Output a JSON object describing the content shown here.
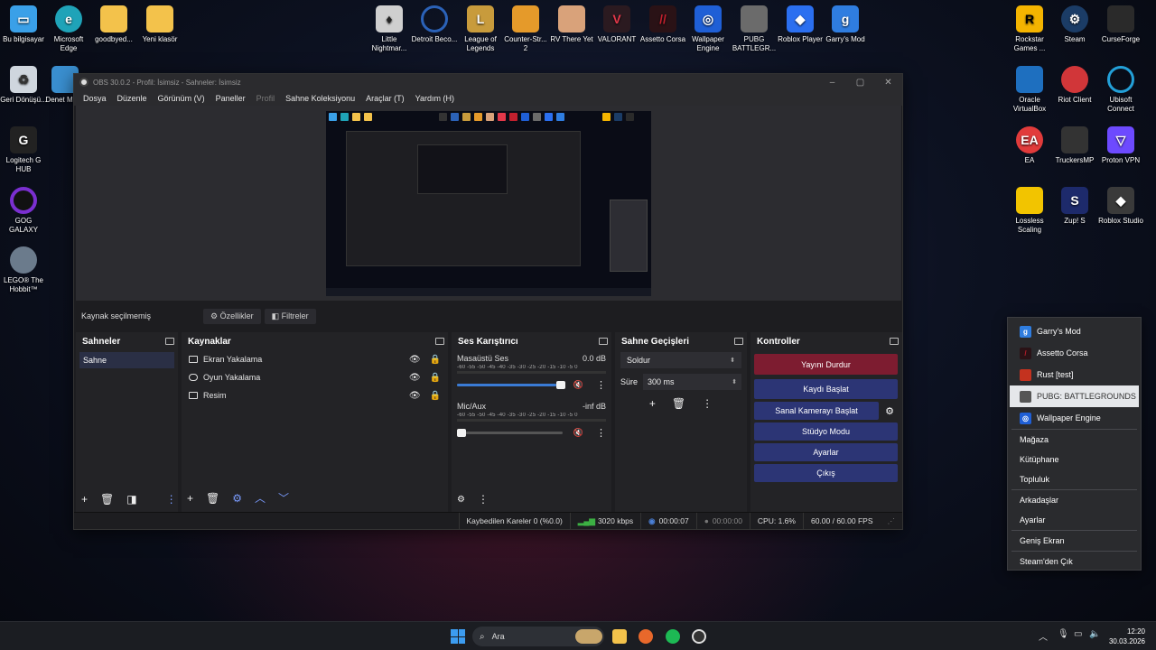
{
  "desktop": {
    "left_icons": [
      {
        "label": "Bu bilgisayar",
        "icon": "monitor-icon",
        "color": "#3aa0e8"
      },
      {
        "label": "Microsoft Edge",
        "icon": "edge-icon",
        "color": "#1fa3b8"
      },
      {
        "label": "goodbyed...",
        "icon": "folder-icon",
        "color": "#f3c24b"
      },
      {
        "label": "Yeni klasör",
        "icon": "folder-icon",
        "color": "#f3c24b"
      },
      {
        "label": "Geri Dönüşü...",
        "icon": "recycle-bin-icon",
        "color": "#cfd6de"
      },
      {
        "label": "Denet Masa",
        "icon": "control-panel-icon",
        "color": "#3a8fd0"
      },
      {
        "label": "Logitech G HUB",
        "icon": "logitech-icon",
        "color": "#222222"
      },
      {
        "label": "GOG GALAXY",
        "icon": "gog-icon",
        "color": "#7a2fd0"
      },
      {
        "label": "LEGO® The Hobbit™",
        "icon": "lego-hobbit-icon",
        "color": "#6b7b8c"
      }
    ],
    "top_icons": [
      {
        "label": "Little Nightmar...",
        "icon": "little-nightmares-icon",
        "color": "#cfcfcf"
      },
      {
        "label": "Detroit Beco...",
        "icon": "detroit-icon",
        "color": "#2b62b8"
      },
      {
        "label": "League of Legends",
        "icon": "lol-icon",
        "color": "#c89b3c"
      },
      {
        "label": "Counter-Str... 2",
        "icon": "cs2-icon",
        "color": "#e59a2a"
      },
      {
        "label": "RV There Yet",
        "icon": "rv-there-yet-icon",
        "color": "#d9a27a"
      },
      {
        "label": "VALORANT",
        "icon": "valorant-icon",
        "color": "#e3384a"
      },
      {
        "label": "Assetto Corsa",
        "icon": "assetto-corsa-icon",
        "color": "#c2202e"
      },
      {
        "label": "Wallpaper Engine",
        "icon": "wallpaper-engine-icon",
        "color": "#1f5fd6"
      },
      {
        "label": "PUBG BATTLEGR...",
        "icon": "pubg-icon",
        "color": "#6b6b6b"
      },
      {
        "label": "Roblox Player",
        "icon": "roblox-icon",
        "color": "#2b6ff0"
      },
      {
        "label": "Garry's Mod",
        "icon": "garrys-mod-icon",
        "color": "#2f7de0"
      }
    ],
    "right_icons": [
      {
        "label": "Rockstar Games ...",
        "icon": "rockstar-icon",
        "color": "#f4b400"
      },
      {
        "label": "Steam",
        "icon": "steam-icon",
        "color": "#1b3c66"
      },
      {
        "label": "CurseForge",
        "icon": "curseforge-icon",
        "color": "#2a2a2a"
      },
      {
        "label": "Oracle VirtualBox",
        "icon": "virtualbox-icon",
        "color": "#1e6fbf"
      },
      {
        "label": "Riot Client",
        "icon": "riot-icon",
        "color": "#d13639"
      },
      {
        "label": "Ubisoft Connect",
        "icon": "ubisoft-icon",
        "color": "#23a0d8"
      },
      {
        "label": "EA",
        "icon": "ea-icon",
        "color": "#e13b3b"
      },
      {
        "label": "TruckersMP",
        "icon": "truckersmp-icon",
        "color": "#333333"
      },
      {
        "label": "Proton VPN",
        "icon": "protonvpn-icon",
        "color": "#6d4aff"
      },
      {
        "label": "Lossless Scaling",
        "icon": "lossless-scaling-icon",
        "color": "#f2c400"
      },
      {
        "label": "Zup! S",
        "icon": "zup-icon",
        "color": "#1d2a6b"
      },
      {
        "label": "Roblox Studio",
        "icon": "roblox-studio-icon",
        "color": "#3a3a3a"
      }
    ]
  },
  "obs": {
    "title": "OBS 30.0.2 - Profil: İsimsiz - Sahneler: İsimsiz",
    "menu": [
      "Dosya",
      "Düzenle",
      "Görünüm (V)",
      "Paneller",
      "Profil",
      "Sahne Koleksiyonu",
      "Araçlar (T)",
      "Yardım (H)"
    ],
    "source_bar": {
      "no_selection": "Kaynak seçilmemiş",
      "properties": "Özellikler",
      "filters": "Filtreler"
    },
    "scenes": {
      "title": "Sahneler",
      "items": [
        "Sahne"
      ]
    },
    "sources": {
      "title": "Kaynaklar",
      "items": [
        "Ekran Yakalama",
        "Oyun Yakalama",
        "Resim"
      ]
    },
    "mixer": {
      "title": "Ses Karıştırıcı",
      "scale": "-60 -55 -50 -45 -40 -35 -30 -25 -20 -15 -10 -5 0",
      "channels": [
        {
          "name": "Masaüstü Ses",
          "level": "0.0 dB",
          "volume": 1.0
        },
        {
          "name": "Mic/Aux",
          "level": "-inf dB",
          "volume": 0.0
        }
      ]
    },
    "transitions": {
      "title": "Sahne Geçişleri",
      "selected": "Soldur",
      "duration_label": "Süre",
      "duration_value": "300 ms"
    },
    "controls": {
      "title": "Kontroller",
      "stop_stream": "Yayını Durdur",
      "start_record": "Kaydı Başlat",
      "virtual_cam": "Sanal Kamerayı Başlat",
      "studio_mode": "Stüdyo Modu",
      "settings": "Ayarlar",
      "exit": "Çıkış"
    },
    "status": {
      "dropped": "Kaybedilen Kareler 0 (%0.0)",
      "bitrate": "3020 kbps",
      "stream_time": "00:00:07",
      "record_time": "00:00:00",
      "cpu": "CPU: 1.6%",
      "fps": "60.00 / 60.00 FPS"
    }
  },
  "steam_menu": {
    "games": [
      {
        "label": "Garry's Mod",
        "icon": "garrys-mod-icon",
        "color": "#2f7de0"
      },
      {
        "label": "Assetto Corsa",
        "icon": "assetto-corsa-icon",
        "color": "#b81d2a"
      },
      {
        "label": "Rust [test]",
        "icon": "rust-icon",
        "color": "#c4321f"
      },
      {
        "label": "PUBG: BATTLEGROUNDS",
        "icon": "pubg-icon",
        "color": "#555555"
      },
      {
        "label": "Wallpaper Engine",
        "icon": "wallpaper-engine-icon",
        "color": "#1f5fd6"
      }
    ],
    "items": [
      "Mağaza",
      "Kütüphane",
      "Topluluk",
      "Arkadaşlar",
      "Ayarlar",
      "Geniş Ekran",
      "Steam'den Çık"
    ]
  },
  "taskbar": {
    "search_placeholder": "Ara",
    "time": "12:20",
    "date": "30.03.2026"
  }
}
